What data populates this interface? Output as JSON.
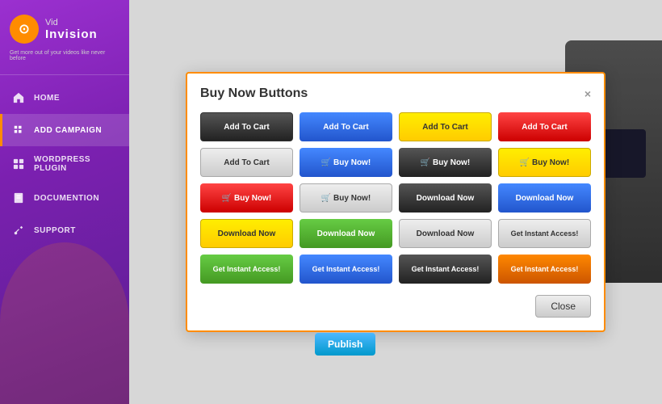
{
  "app": {
    "name": "VidInvision",
    "tagline": "Get more out of your videos like never before"
  },
  "sidebar": {
    "logo": {
      "vid": "Vid",
      "invision": "Invision"
    },
    "nav": [
      {
        "id": "home",
        "label": "HOME",
        "icon": "home"
      },
      {
        "id": "add-campaign",
        "label": "ADD CAMPAIGN",
        "icon": "plus",
        "active": true
      },
      {
        "id": "wordpress-plugin",
        "label": "WORDPRESS PLUGIN",
        "icon": "puzzle"
      },
      {
        "id": "documentation",
        "label": "DOCUMENTION",
        "icon": "book"
      },
      {
        "id": "support",
        "label": "SUPPORT",
        "icon": "wrench"
      }
    ]
  },
  "modal": {
    "title": "Buy Now Buttons",
    "close_x": "×",
    "close_btn": "Close",
    "buttons": [
      {
        "label": "Add To Cart",
        "style": "dark",
        "icon": false
      },
      {
        "label": "Add To Cart",
        "style": "blue",
        "icon": false
      },
      {
        "label": "Add To Cart",
        "style": "yellow",
        "icon": false
      },
      {
        "label": "Add To Cart",
        "style": "red",
        "icon": false
      },
      {
        "label": "Add To Cart",
        "style": "silver",
        "icon": false
      },
      {
        "label": "🛒 Buy Now!",
        "style": "blue",
        "icon": true
      },
      {
        "label": "🛒 Buy Now!",
        "style": "dark",
        "icon": true
      },
      {
        "label": "🛒 Buy Now!",
        "style": "yellow",
        "icon": true
      },
      {
        "label": "🛒 Buy Now!",
        "style": "red",
        "icon": true
      },
      {
        "label": "🛒 Buy Now!",
        "style": "silver",
        "icon": true
      },
      {
        "label": "Download Now",
        "style": "dark",
        "icon": false
      },
      {
        "label": "Download Now",
        "style": "blue",
        "icon": false
      },
      {
        "label": "Download Now",
        "style": "yellow",
        "icon": false
      },
      {
        "label": "Download Now",
        "style": "green",
        "icon": false
      },
      {
        "label": "Download Now",
        "style": "silver",
        "icon": false
      },
      {
        "label": "Get Instant Access!",
        "style": "ia-silver",
        "icon": false
      },
      {
        "label": "Get Instant Access!",
        "style": "ia-green",
        "icon": false
      },
      {
        "label": "Get Instant Access!",
        "style": "ia-blue",
        "icon": false
      },
      {
        "label": "Get Instant Access!",
        "style": "ia-dark",
        "icon": false
      },
      {
        "label": "Get Instant Access!",
        "style": "ia-orange",
        "icon": false
      }
    ]
  },
  "publish_btn": "Publish"
}
